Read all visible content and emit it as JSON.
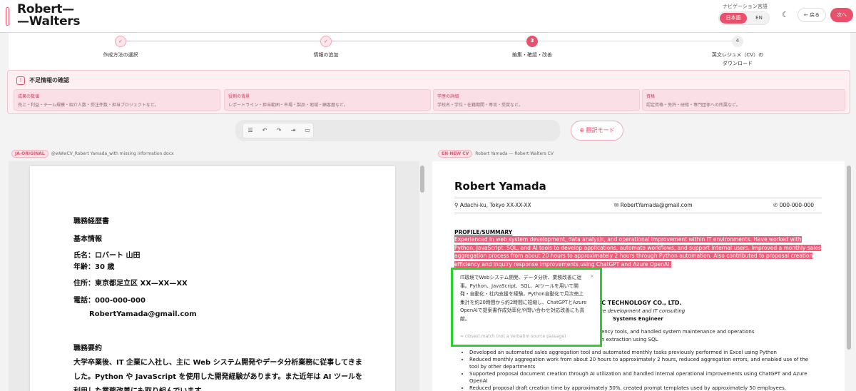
{
  "header": {
    "logo_line1": "Robert—",
    "logo_line2": "—Walters",
    "nav_lang_label": "ナビゲーション言語",
    "lang_jp": "日本語",
    "lang_en": "EN",
    "back_label": "戻る",
    "next_label": "次へ",
    "brand_color": "#e8506c"
  },
  "stepper": {
    "steps": [
      {
        "num": "✓",
        "label": "作成方法の選択",
        "state": "done"
      },
      {
        "num": "✓",
        "label": "情報の追加",
        "state": "done"
      },
      {
        "num": "3",
        "label": "編集・確認・改善",
        "state": "active"
      },
      {
        "num": "4",
        "label": "英文レジュメ（CV）の",
        "label2": "ダウンロード",
        "state": "todo"
      }
    ]
  },
  "missing": {
    "title": "不足情報の確認",
    "cards": [
      {
        "title": "成果の数値",
        "desc": "売上・利益・チーム規模・紹介人数・受注件数・担当プロジェクトなど。"
      },
      {
        "title": "役割の背景",
        "desc": "レポートライン・担当範囲・市場・製品・地域・顧客層など。"
      },
      {
        "title": "学歴の詳細",
        "desc": "学校名・学位・在籍期間・専攻・受賞など。"
      },
      {
        "title": "資格",
        "desc": "認定資格・免許・研修・専門団体への所属など。"
      }
    ]
  },
  "toolbar": {
    "translate_label": "翻訳モード"
  },
  "left_pane": {
    "tag": "JA·ORIGINAL",
    "filename": "@wWwCV_Robert Yamada_with missing information.docx",
    "doc": {
      "title": "職務経歴書",
      "basic": "基本情報",
      "name": "氏名：ロバート 山田",
      "age": "年齢：30 歳",
      "address": "住所：東京都足立区 XX—XX—XX",
      "phone": "電話：000-000-000",
      "email": "RobertYamada@gmail.com",
      "summary_title": "職務要約",
      "summary_body": "大学卒業後、IT 企業に入社し、主に Web システム開発やデータ分析業務に従事してきました。Python や JavaScript を使用した開発経験があります。また近年は AI ツールを利用した業務改善にも取り組んでいます。"
    }
  },
  "right_pane": {
    "tag": "EN·NEW CV",
    "title": "Robert Yamada — Robert Walters CV",
    "cv": {
      "name": "Robert Yamada",
      "location": "Adachi-ku, Tokyo XX-XX-XX",
      "email": "RobertYamada@gmail.com",
      "phone": "000-000-000",
      "section": "PROFILE/SUMMARY",
      "summary": "Experienced in web system development, data analysis, and operational improvement within IT environments. Have worked with Python, JavaScript, SQL, and AI tools to develop applications, automate workflows, and support internal users. Improved a monthly sales aggregation process from about 20 hours to approximately 2 hours through Python automation. Also contributed to proposal creation efficiency and inquiry response improvements using ChatGPT and Azure OpenAI.",
      "company": "BC TECHNOLOGY CO., LTD.",
      "company_sub": "are development and IT consulting",
      "role": "Systems Engineer",
      "frag1": "ency tools, and handled system maintenance and operations",
      "frag2": "n extraction using SQL",
      "bullets": [
        "Developed an automated sales aggregation tool and automated monthly tasks previously performed in Excel using Python",
        "Reduced monthly aggregation work from about 20 hours to approximately 2 hours, reduced aggregation errors, and enabled use of the tool by other departments",
        "Supported proposal document creation through AI utilization and handled internal operational improvements using ChatGPT and Azure OpenAI",
        "Reduced proposal draft creation time by approximately 50%, created prompt templates used by approximately 50 employees,"
      ]
    }
  },
  "popup": {
    "text": "IT環境でWebシステム開発、データ分析、業務改善に従事。Python、JavaScript、SQL、AIツールを用いて開発・自動化・社内支援を経験。Python自動化で月次売上集計を約20時間から約2時間に短縮し、ChatGPTとAzure OpenAIで提案書作成効率化や問い合わせ対応改善にも貢献。",
    "close": "×",
    "note": "≈ closest match (not a verbatim source passage)",
    "border_color": "#2bd12b"
  }
}
